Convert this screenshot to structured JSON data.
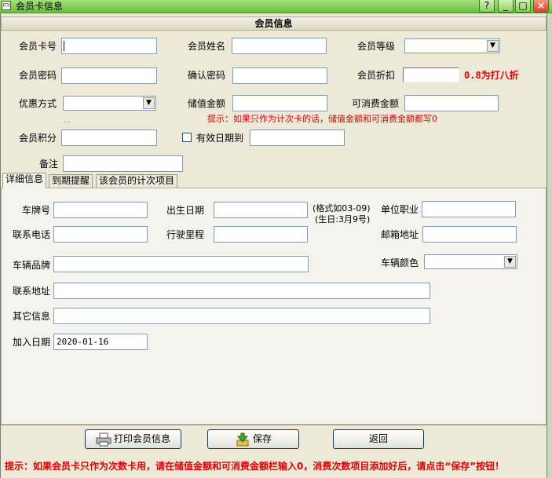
{
  "window": {
    "title": "会员卡信息",
    "sys_icon": "▭",
    "help_label": "?",
    "min_label": "_",
    "max_label": "□",
    "close_label": "×"
  },
  "section_title": "会员信息",
  "form": {
    "card_no_label": "会员卡号",
    "card_no_value": "",
    "name_label": "会员姓名",
    "name_value": "",
    "level_label": "会员等级",
    "level_value": "",
    "password_label": "会员密码",
    "password_value": "",
    "confirm_label": "确认密码",
    "confirm_value": "",
    "discount_label": "会员折扣",
    "discount_value": "",
    "discount_hint": "0.8为打八折",
    "promo_label": "优惠方式",
    "promo_value": "",
    "promo_more": "...",
    "balance_label": "储值金额",
    "balance_value": "",
    "spendable_label": "可消费金额",
    "spendable_value": "",
    "count_card_hint": "提示：如果只作为计次卡的话，储值金额和可消费金额都写0",
    "points_label": "会员积分",
    "points_value": "",
    "expiry_label": "有效日期到",
    "expiry_value": "",
    "notes_label": "备注",
    "notes_value": ""
  },
  "tabs": [
    {
      "label": "详细信息"
    },
    {
      "label": "到期提醒"
    },
    {
      "label": "该会员的计次项目"
    }
  ],
  "details": {
    "plate_label": "车牌号",
    "plate_value": "",
    "birth_label": "出生日期",
    "birth_value": "",
    "birth_format_1": "(格式如03-09)",
    "birth_format_2": "(生日:3月9号)",
    "job_label": "单位职业",
    "job_value": "",
    "phone_label": "联系电话",
    "phone_value": "",
    "mileage_label": "行驶里程",
    "mileage_value": "",
    "email_label": "邮箱地址",
    "email_value": "",
    "brand_label": "车辆品牌",
    "brand_value": "",
    "color_label": "车辆颜色",
    "color_value": "",
    "address_label": "联系地址",
    "address_value": "",
    "other_label": "其它信息",
    "other_value": "",
    "join_label": "加入日期",
    "join_value": "2020-01-16"
  },
  "buttons": {
    "print_label": "打印会员信息",
    "save_label": "保存",
    "back_label": "返回"
  },
  "bottom_hint": "提示：如果会员卡只作为次数卡用，请在储值金额和可消费金额栏输入0，消费次数项目添加好后，请点击“保存”按钮！",
  "colors": {
    "titlebar": "#8ad060",
    "hint_red": "#e00000",
    "panel_bg": "#f4f3ee",
    "window_bg": "#ece9d8"
  }
}
